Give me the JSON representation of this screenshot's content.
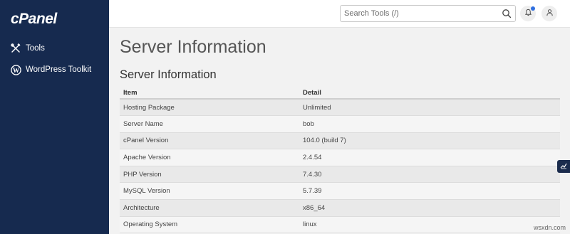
{
  "sidebar": {
    "logo": "cPanel",
    "items": [
      {
        "label": "Tools",
        "icon": "tools-icon"
      },
      {
        "label": "WordPress Toolkit",
        "icon": "wordpress-icon"
      }
    ]
  },
  "topbar": {
    "search_placeholder": "Search Tools (/)",
    "search_icon": "search-icon",
    "notifications_icon": "bell-icon",
    "user_icon": "user-icon",
    "notification_dot_color": "#2f6fe0"
  },
  "main": {
    "page_title": "Server Information",
    "section_title": "Server Information",
    "table": {
      "headers": {
        "item": "Item",
        "detail": "Detail"
      },
      "rows": [
        {
          "item": "Hosting Package",
          "detail": "Unlimited"
        },
        {
          "item": "Server Name",
          "detail": "bob"
        },
        {
          "item": "cPanel Version",
          "detail": "104.0 (build 7)"
        },
        {
          "item": "Apache Version",
          "detail": "2.4.54"
        },
        {
          "item": "PHP Version",
          "detail": "7.4.30"
        },
        {
          "item": "MySQL Version",
          "detail": "5.7.39"
        },
        {
          "item": "Architecture",
          "detail": "x86_64"
        },
        {
          "item": "Operating System",
          "detail": "linux"
        }
      ]
    }
  },
  "side_tab_icon": "chart-icon",
  "watermark": "wsxdn.com",
  "colors": {
    "sidebar_bg": "#162a4f",
    "page_bg": "#f2f2f2",
    "accent": "#2f6fe0"
  }
}
